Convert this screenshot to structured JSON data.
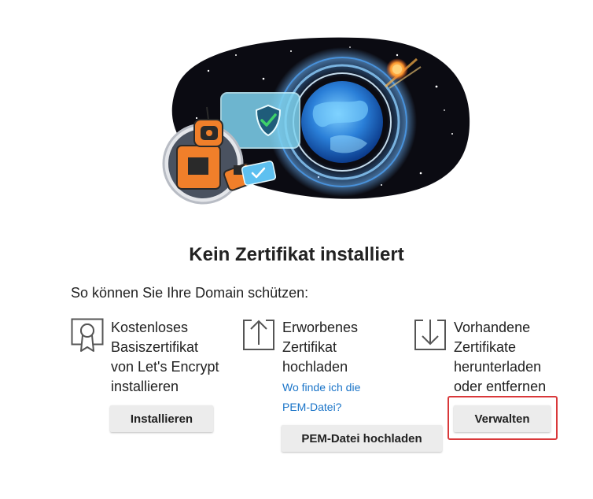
{
  "title": "Kein Zertifikat installiert",
  "intro": "So können Sie Ihre Domain schützen:",
  "options": [
    {
      "icon": "certificate-badge-icon",
      "text": "Kostenloses\nBasiszertifikat\nvon Let's Encrypt\ninstallieren",
      "button": "Installieren"
    },
    {
      "icon": "upload-arrow-icon",
      "text": "Erworbenes\nZertifikat\nhochladen",
      "link": "Wo finde ich die\nPEM-Datei?",
      "button": "PEM-Datei hochladen"
    },
    {
      "icon": "download-arrow-icon",
      "text": "Vorhandene\nZertifikate\nherunterladen\noder entfernen",
      "button": "Verwalten"
    }
  ],
  "colors": {
    "link": "#1a74c8",
    "highlight": "#d9383a",
    "button_bg": "#ececec",
    "robot_orange": "#f07f2a",
    "space": "#0b0b12"
  }
}
